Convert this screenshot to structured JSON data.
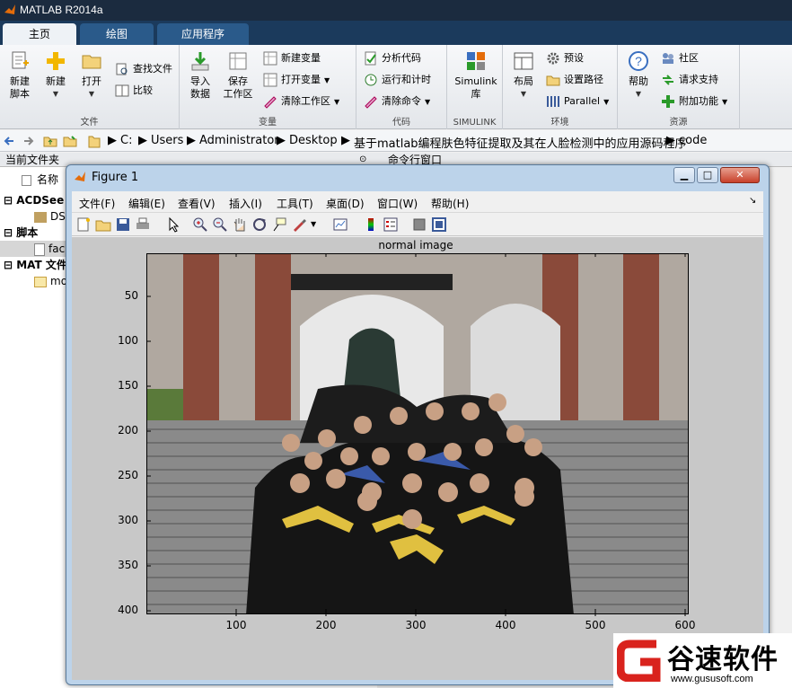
{
  "app": {
    "title": "MATLAB R2014a"
  },
  "tabs": [
    {
      "label": "主页"
    },
    {
      "label": "绘图"
    },
    {
      "label": "应用程序"
    }
  ],
  "ribbon": {
    "file": {
      "label": "文件",
      "new_script": "新建\n脚本",
      "new": "新建",
      "open": "打开",
      "find_files": "查找文件",
      "compare": "比较"
    },
    "variable": {
      "label": "变量",
      "import": "导入\n数据",
      "save_ws": "保存\n工作区",
      "new_var": "新建变量",
      "open_var": "打开变量",
      "clear_ws": "清除工作区"
    },
    "code": {
      "label": "代码",
      "analyze": "分析代码",
      "run_time": "运行和计时",
      "clear_cmd": "清除命令"
    },
    "simulink": {
      "label": "SIMULINK",
      "lib": "Simulink\n库"
    },
    "env": {
      "label": "环境",
      "layout": "布局",
      "prefs": "预设",
      "set_path": "设置路径",
      "parallel": "Parallel"
    },
    "resources": {
      "label": "资源",
      "help": "帮助",
      "community": "社区",
      "support": "请求支持",
      "addons": "附加功能"
    }
  },
  "address": {
    "parts": [
      "C:",
      "Users",
      "Administrator",
      "Desktop",
      "基于matlab编程肤色特征提取及其在人脸检测中的应用源码程序",
      "code"
    ]
  },
  "left_panel": {
    "header": "当前文件夹",
    "col_name": "名称",
    "groups": [
      {
        "title": "ACDSee",
        "item": "DS"
      },
      {
        "title": "脚本",
        "item": "fac"
      },
      {
        "title": "MAT 文件",
        "item": "mo"
      }
    ]
  },
  "command_window": {
    "header": "命令行窗口"
  },
  "figure": {
    "title": "Figure 1",
    "menu": [
      "文件(F)",
      "编辑(E)",
      "查看(V)",
      "插入(I)",
      "工具(T)",
      "桌面(D)",
      "窗口(W)",
      "帮助(H)"
    ],
    "plot_title": "normal image",
    "yticks": [
      "50",
      "100",
      "150",
      "200",
      "250",
      "300",
      "350",
      "400"
    ],
    "xticks": [
      "100",
      "200",
      "300",
      "400",
      "500",
      "600"
    ]
  },
  "watermark": {
    "name": "谷速软件",
    "url": "www.gususoft.com"
  },
  "colors": {
    "titlebar": "#1b2b3f",
    "tabbar": "#1b3a5c",
    "accent": "#e46c0a",
    "wm_red": "#d9231d"
  }
}
